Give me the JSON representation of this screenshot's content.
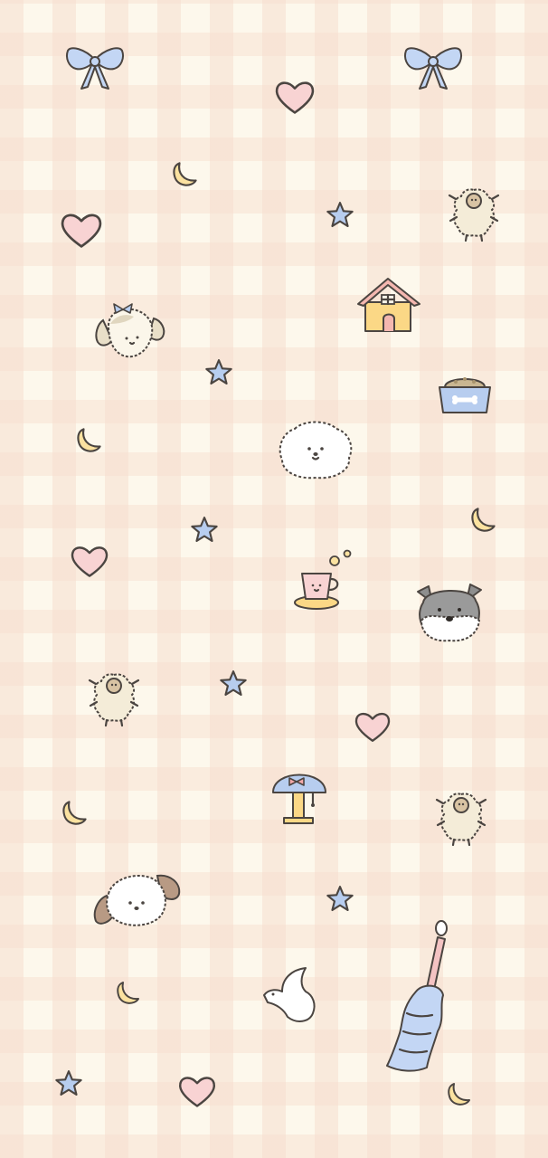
{
  "wallpaper": {
    "palette": {
      "background": "#fdf8ec",
      "gingham": "#f6dece",
      "heart": "#f8d3d3",
      "star": "#b7cdef",
      "moon": "#fbe2a0",
      "bow": "#c3d6f4",
      "outline": "#4b4541"
    },
    "stickers": [
      "bow-icon",
      "heart-icon",
      "moon-icon",
      "star-icon",
      "sheep-icon",
      "dog-face-icon",
      "dog-house-icon",
      "dog-food-bowl-icon",
      "fluffy-dog-icon",
      "teacup-icon",
      "schnauzer-face-icon",
      "mushroom-lamp-icon",
      "floppy-ear-dog-icon",
      "bird-icon",
      "candle-icon"
    ]
  }
}
